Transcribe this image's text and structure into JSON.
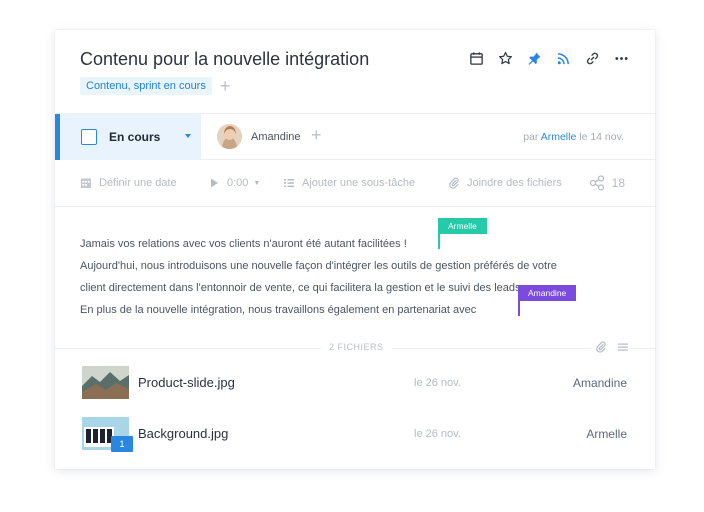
{
  "task": {
    "title": "Contenu pour la nouvelle intégration",
    "tags": [
      "Contenu, sprint en cours"
    ],
    "actions": [
      "calendar-icon",
      "star-icon",
      "pin-icon",
      "rss-icon",
      "link-icon",
      "more-icon"
    ]
  },
  "status": {
    "label": "En cours",
    "assignee": "Amandine",
    "by_prefix": "par",
    "author": "Armelle",
    "date": "le 14 nov."
  },
  "tools": {
    "date_label": "Définir une date",
    "timer_label": "0:00",
    "subtask_label": "Ajouter une sous-tâche",
    "attach_label": "Joindre des fichiers",
    "followers_count": "18"
  },
  "description": {
    "lines": [
      "Jamais vos relations avec vos clients n'auront été autant facilitées !",
      "Aujourd'hui, nous introduisons une nouvelle façon d'intégrer les outils de gestion préférés de votre",
      "client directement dans l'entonnoir de vente, ce qui facilitera la gestion et le suivi des leads.",
      "En plus de la nouvelle intégration, nous travaillons également en partenariat avec"
    ],
    "cursors": [
      {
        "name": "Armelle",
        "color": "#26c9a8"
      },
      {
        "name": "Amandine",
        "color": "#7b4be0"
      }
    ]
  },
  "files": {
    "header": "2 FICHIERS",
    "items": [
      {
        "name": "Product-slide.jpg",
        "date": "le 26 nov.",
        "user": "Amandine"
      },
      {
        "name": "Background.jpg",
        "date": "le 26 nov.",
        "user": "Armelle",
        "comments": "1"
      }
    ]
  }
}
